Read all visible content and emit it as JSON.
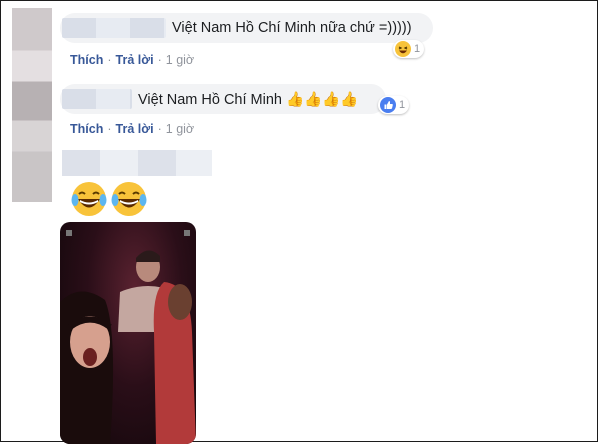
{
  "comments": [
    {
      "text": "Việt Nam Hồ Chí Minh nữa chứ =)))))",
      "reaction": {
        "type": "haha-icon",
        "count": "1"
      },
      "actions": {
        "like": "Thích",
        "reply": "Trả lời",
        "sep": "·",
        "time": "1 giờ"
      }
    },
    {
      "text": "Việt Nam Hồ Chí Minh",
      "emojis": "👍👍👍👍",
      "reaction": {
        "type": "like-icon",
        "count": "1"
      },
      "actions": {
        "like": "Thích",
        "reply": "Trả lời",
        "sep": "·",
        "time": "1 giờ"
      }
    }
  ],
  "colors": {
    "link": "#385898",
    "bubble": "#f2f3f5",
    "meta": "#90949c",
    "like": "#4a7ef0",
    "haha": "#f7c33b"
  }
}
